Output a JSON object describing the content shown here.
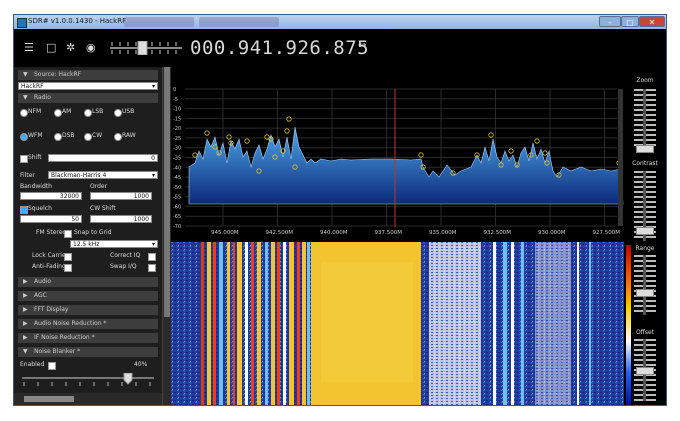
{
  "window": {
    "title": "SDR# v1.0.0.1430 - HackRF"
  },
  "toolbar": {
    "frequency": "000.941.926.875",
    "menu_icon": "hamburger-icon",
    "stop_icon": "stop-icon",
    "settings_icon": "gear-icon",
    "audio_icon": "speaker-icon"
  },
  "panel": {
    "source_header": "Source: HackRF",
    "source_value": "HackRF",
    "radio_header": "Radio",
    "modes_row1": [
      "NFM",
      "AM",
      "LSB",
      "USB"
    ],
    "modes_row2": [
      "WFM",
      "DSB",
      "CW",
      "RAW"
    ],
    "shift_label": "Shift",
    "shift_value": "0",
    "filter_label": "Filter",
    "filter_value": "Blackman-Harris 4",
    "bandwidth_label": "Bandwidth",
    "order_label": "Order",
    "bandwidth_value": "32000",
    "order_value": "1000",
    "squelch_label": "Squelch",
    "cw_shift_label": "CW Shift",
    "squelch_value": "50",
    "cw_shift_value": "1000",
    "fm_stereo_label": "FM Stereo",
    "snap_label": "Snap to Grid",
    "step_value": "12.5 kHz",
    "lock_carrier_label": "Lock Carrier",
    "correct_iq_label": "Correct IQ",
    "anti_fading_label": "Anti-Fading",
    "swap_iq_label": "Swap I/Q",
    "audio_header": "Audio",
    "agc_header": "AGC",
    "fft_header": "FFT Display",
    "anr_header": "Audio Noise Reduction *",
    "ifnr_header": "IF Noise Reduction *",
    "nb_header": "Noise Blanker *",
    "nb_enabled_label": "Enabled",
    "nb_percent": "40%"
  },
  "spectrum": {
    "y_ticks": [
      "0",
      "-5",
      "-10",
      "-15",
      "-20",
      "-25",
      "-30",
      "-35",
      "-40",
      "-45",
      "-50",
      "-55",
      "-60",
      "-65",
      "-70"
    ],
    "x_ticks": [
      "945.000M",
      "942.500M",
      "940.000M",
      "937.500M",
      "935.000M",
      "932.500M",
      "930.000M",
      "927.500M"
    ]
  },
  "right_panel": {
    "zoom_label": "Zoom",
    "contrast_label": "Contrast",
    "range_label": "Range",
    "offset_label": "Offset"
  }
}
